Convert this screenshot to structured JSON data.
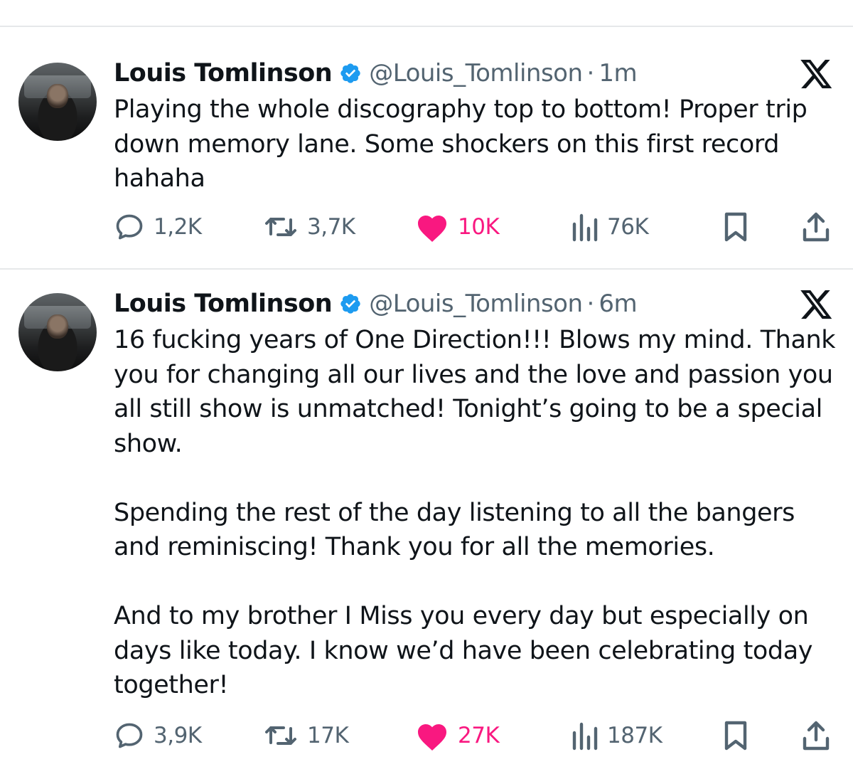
{
  "tweets": [
    {
      "display_name": "Louis Tomlinson",
      "handle": "@Louis_Tomlinson",
      "separator": "·",
      "time": "1m",
      "paragraphs": [
        "Playing the whole discography top to bottom! Proper trip down memory lane. Some shockers on this first record hahaha"
      ],
      "replies": "1,2K",
      "retweets": "3,7K",
      "likes": "10K",
      "views": "76K",
      "liked": true
    },
    {
      "display_name": "Louis Tomlinson",
      "handle": "@Louis_Tomlinson",
      "separator": "·",
      "time": "6m",
      "paragraphs": [
        "16 fucking years of One Direction!!! Blows my mind. Thank you for changing all our lives and the love and passion you all still show is unmatched! Tonight’s going to be a special show.",
        "Spending the rest of the day listening to all the bangers and reminiscing! Thank you for all the memories.",
        "And to my brother I Miss you every day but especially on days like today. I know we’d have been celebrating today together!"
      ],
      "replies": "3,9K",
      "retweets": "17K",
      "likes": "27K",
      "views": "187K",
      "liked": true
    }
  ],
  "icons": {
    "verified": "verified-badge-icon",
    "platform_logo": "x-logo-icon",
    "reply": "reply-bubble-icon",
    "retweet": "retweet-icon",
    "like": "heart-icon",
    "views": "views-bar-chart-icon",
    "bookmark": "bookmark-icon",
    "share": "share-upload-icon"
  },
  "colors": {
    "text_primary": "#0f1419",
    "text_secondary": "#536471",
    "verified_blue": "#1d9bf0",
    "like_pink": "#f91880",
    "divider": "#e6e8ea",
    "background": "#ffffff"
  }
}
